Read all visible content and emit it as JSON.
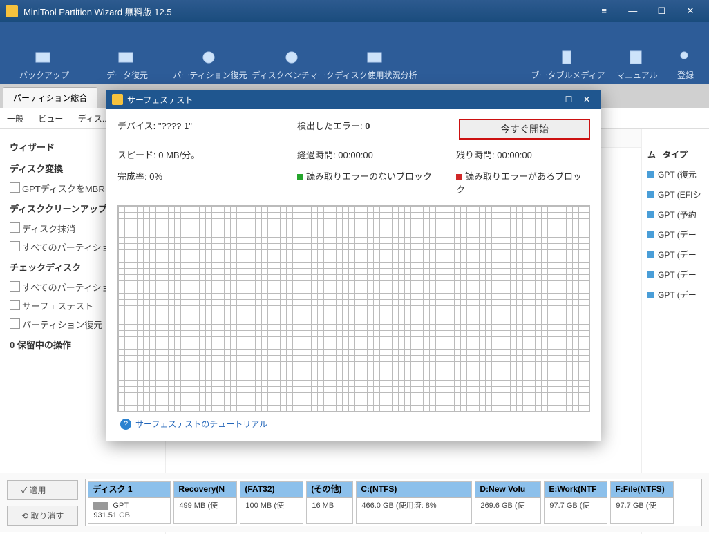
{
  "app": {
    "title": "MiniTool Partition Wizard 無料版 12.5"
  },
  "toolbar": [
    {
      "label": "バックアップ"
    },
    {
      "label": "データ復元"
    },
    {
      "label": "パーティション復元"
    },
    {
      "label": "ディスクベンチマーク"
    },
    {
      "label": "ディスク使用状況分析"
    }
  ],
  "toolbar_right": [
    {
      "label": "ブータブルメディア"
    },
    {
      "label": "マニュアル"
    },
    {
      "label": "登録"
    }
  ],
  "tab": "パーティション総合",
  "subtabs": [
    "一般",
    "ビュー",
    "ディス..."
  ],
  "sidebar": {
    "wiz": "ウィザード",
    "g1": "ディスク変換",
    "i1": "GPTディスクをMBR",
    "g2": "ディスククリーンアップ",
    "i2": "ディスク抹消",
    "i3": "すべてのパーティショ",
    "g3": "チェックディスク",
    "i4": "すべてのパーティショ",
    "i5": "サーフェステスト",
    "i6": "パーティション復元",
    "pending": "0 保留中の操作"
  },
  "right": {
    "col_mu": "ム",
    "col_type": "タイプ",
    "rows": [
      "GPT (復元",
      "GPT (EFIシ",
      "GPT (予約",
      "GPT (デー",
      "GPT (デー",
      "GPT (デー",
      "GPT (デー"
    ]
  },
  "bottom": {
    "apply": "✓ 適用",
    "undo": "⟲ 取り消す",
    "disk": {
      "name": "ディスク 1",
      "scheme": "GPT",
      "size": "931.51 GB"
    },
    "parts": [
      {
        "h": "Recovery(N",
        "a": "499 MB (使"
      },
      {
        "h": "(FAT32)",
        "a": "100 MB (使"
      },
      {
        "h": "(その他)",
        "a": "16 MB"
      },
      {
        "h": "C:(NTFS)",
        "a": "466.0 GB (使用済: 8%"
      },
      {
        "h": "D:New Volu",
        "a": "269.6 GB (使"
      },
      {
        "h": "E:Work(NTF",
        "a": "97.7 GB (使"
      },
      {
        "h": "F:File(NTFS)",
        "a": "97.7 GB (使"
      }
    ]
  },
  "dialog": {
    "title": "サーフェステスト",
    "device_l": "デバイス:",
    "device_v": "\"???? 1\"",
    "err_l": "検出したエラー:",
    "err_v": "0",
    "start": "今すぐ開始",
    "speed_l": "スピード:",
    "speed_v": "0 MB/分。",
    "elapsed_l": "経過時間:",
    "elapsed_v": "00:00:00",
    "remain_l": "残り時間:",
    "remain_v": "00:00:00",
    "comp_l": "完成率:",
    "comp_v": "0%",
    "ok_l": "読み取りエラーのないブロック",
    "ng_l": "読み取りエラーがあるブロック",
    "link": "サーフェステストのチュートリアル"
  }
}
